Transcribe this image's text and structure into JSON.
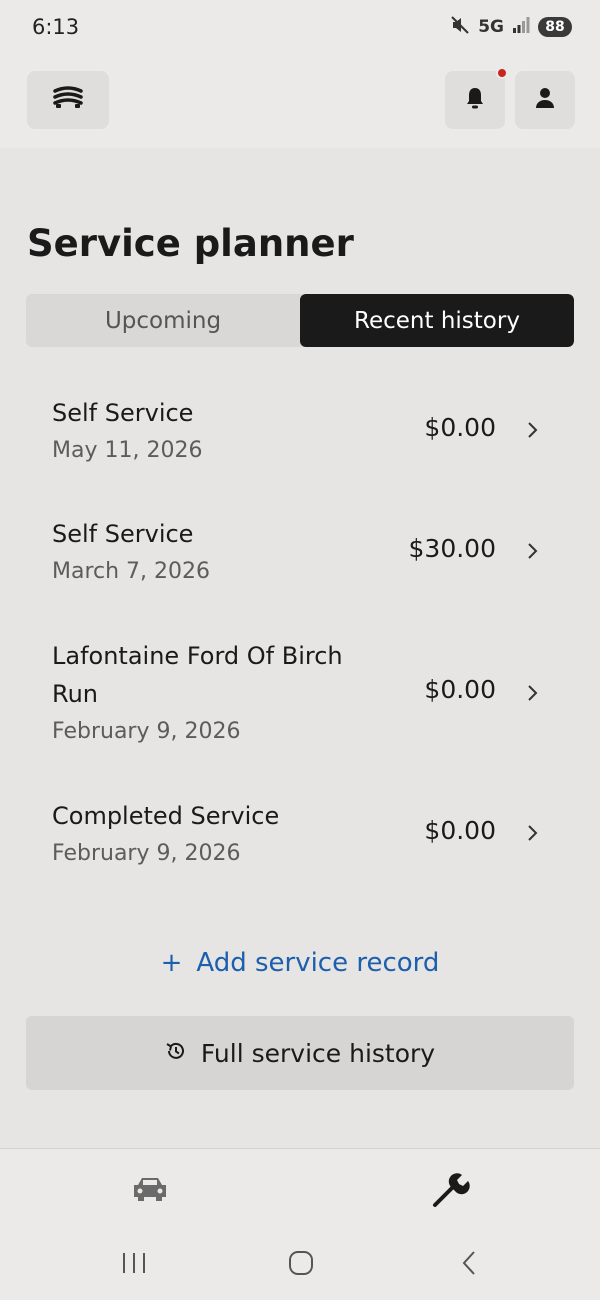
{
  "status_bar": {
    "time": "6:13",
    "network": "5G",
    "battery": "88"
  },
  "header": {
    "notification_dot_color": "#c8261c"
  },
  "page": {
    "title": "Service planner"
  },
  "tabs": [
    {
      "label": "Upcoming",
      "active": false
    },
    {
      "label": "Recent history",
      "active": true
    }
  ],
  "history": [
    {
      "title": "Self Service",
      "date": "May 11, 2026",
      "amount": "$0.00"
    },
    {
      "title": "Self Service",
      "date": "March 7, 2026",
      "amount": "$30.00"
    },
    {
      "title": "Lafontaine Ford Of Birch Run",
      "date": "February 9, 2026",
      "amount": "$0.00"
    },
    {
      "title": "Completed Service",
      "date": "February 9, 2026",
      "amount": "$0.00"
    }
  ],
  "actions": {
    "add_plus": "+",
    "add_record_label": "Add service record",
    "full_history_label": "Full service history"
  },
  "bottom_nav": [
    {
      "icon": "car-icon",
      "active": false
    },
    {
      "icon": "wrench-icon",
      "active": true
    }
  ],
  "colors": {
    "accent_link": "#1b5fae",
    "active_tab": "#1a1a1a"
  }
}
